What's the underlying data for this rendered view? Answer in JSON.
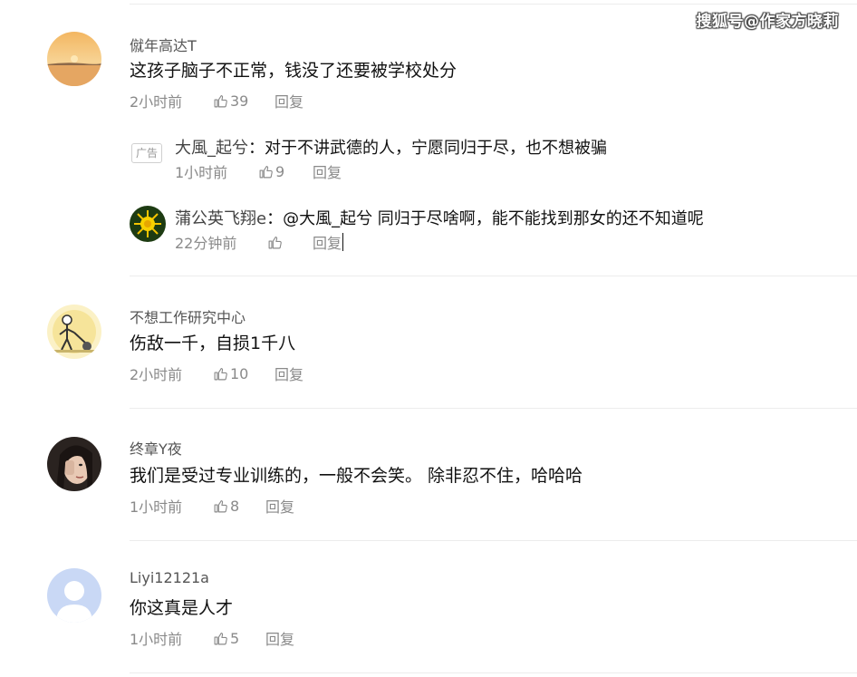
{
  "watermark": "搜狐号@作家方晓莉",
  "comments": [
    {
      "user": "僦年高达T",
      "text": "这孩子脑子不正常，钱没了还要被学校处分",
      "time": "2小时前",
      "likes": "39",
      "reply": "回复",
      "avatar_icon": "sunset-lake-avatar",
      "replies": [
        {
          "badge": "广告",
          "user": "大風_起兮",
          "sep": "：",
          "text": "对于不讲武德的人，宁愿同归于尽，也不想被骗",
          "time": "1小时前",
          "likes": "9",
          "reply": "回复"
        },
        {
          "user": "蒲公英飞翔e",
          "sep": "：",
          "text": "@大風_起兮 同归于尽啥啊，能不能找到那女的还不知道呢",
          "time": "22分钟前",
          "likes": "",
          "reply": "回复",
          "avatar_icon": "dandelion-avatar"
        }
      ]
    },
    {
      "user": "不想工作研究中心",
      "text": "伤敌一千，自损1千八",
      "time": "2小时前",
      "likes": "10",
      "reply": "回复",
      "avatar_icon": "cartoon-figure-avatar"
    },
    {
      "user": "终章Y夜",
      "text": "我们是受过专业训练的，一般不会笑。 除非忍不住，哈哈哈",
      "time": "1小时前",
      "likes": "8",
      "reply": "回复",
      "avatar_icon": "portrait-avatar"
    },
    {
      "user": "Liyi12121a",
      "text": "你这真是人才",
      "time": "1小时前",
      "likes": "5",
      "reply": "回复",
      "avatar_icon": "default-user-avatar"
    }
  ],
  "colors": {
    "meta": "#8a8a8a",
    "text": "#111111",
    "divider": "#ececec",
    "default_avatar_bg": "#c9d8f5"
  }
}
